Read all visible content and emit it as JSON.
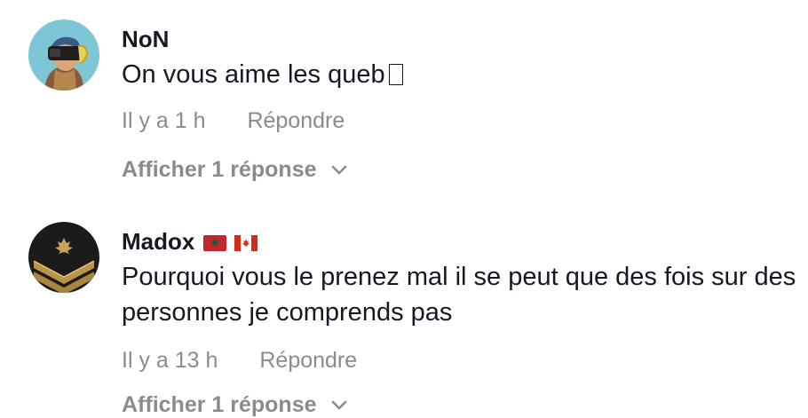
{
  "comments": [
    {
      "username": "NoN",
      "avatar_icon": "vr-headset-girl-avatar",
      "text": "On vous aime les queb",
      "emoji_icon": "missing-glyph-emoji",
      "time": "Il y a 1 h",
      "reply_label": "Répondre",
      "more_replies": "Afficher 1 réponse"
    },
    {
      "username": "Madox",
      "flags": [
        "morocco-flag-icon",
        "canada-flag-icon"
      ],
      "avatar_icon": "military-chevron-avatar",
      "text": "Pourquoi vous le prenez mal il se peut que des fois sur des personnes je comprends pas",
      "time": "Il y a 13 h",
      "reply_label": "Répondre",
      "more_replies": "Afficher 1 réponse"
    }
  ],
  "colors": {
    "primary_text": "#161823",
    "secondary_text": "#8a8b91",
    "avatar1_bg": "#7cc6d6",
    "avatar2_bg": "#1b1b1b"
  }
}
